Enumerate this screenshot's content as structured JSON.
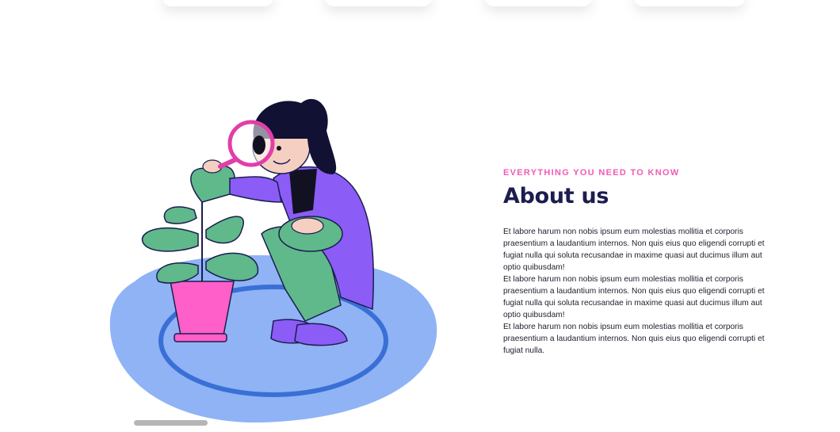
{
  "about": {
    "eyebrow": "EVERYTHING YOU NEED TO KNOW",
    "title": "About us",
    "paragraphs": [
      "Et labore harum non nobis ipsum eum molestias mollitia et corporis praesentium a laudantium internos. Non quis eius quo eligendi corrupti et fugiat nulla qui soluta recusandae in maxime quasi aut ducimus illum aut optio quibusdam!",
      "Et labore harum non nobis ipsum eum molestias mollitia et corporis praesentium a laudantium internos. Non quis eius quo eligendi corrupti et fugiat nulla qui soluta recusandae in maxime quasi aut ducimus illum aut optio quibusdam!",
      "Et labore harum non nobis ipsum eum molestias mollitia et corporis praesentium a laudantium internos. Non quis eius quo eligendi corrupti et fugiat nulla."
    ]
  },
  "colors": {
    "accent_pink": "#f05bb8",
    "title_navy": "#1c1d4f",
    "rug_blue": "#8fb3f5",
    "plant_green": "#5fb98b",
    "coat_purple": "#8b5cf6"
  },
  "icons": {
    "illustration": "woman-inspecting-plant-illustration"
  }
}
